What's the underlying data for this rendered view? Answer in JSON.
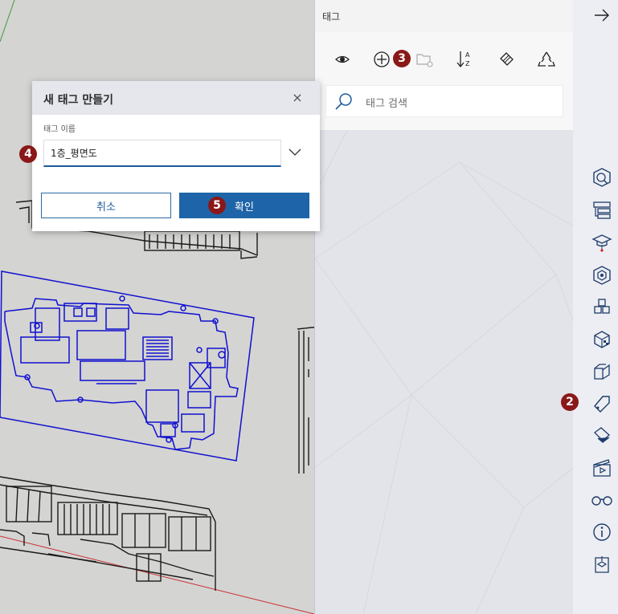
{
  "tag_panel": {
    "title": "태그",
    "search_placeholder": "태그 검색",
    "toolbar": [
      "eye-icon",
      "add-tag-icon",
      "folder-icon",
      "sort-az-icon",
      "tag-tool-icon",
      "purge-icon"
    ]
  },
  "right_tray": {
    "collapse_icon": "arrow-right-icon",
    "icons": [
      "entity-info-icon",
      "outliner-icon",
      "instructor-icon",
      "components-icon",
      "materials-cubes-icon",
      "styles-icon",
      "shadows-icon",
      "tags-icon",
      "soften-edges-icon",
      "scenes-icon",
      "glasses-icon",
      "info-icon",
      "export-icon"
    ]
  },
  "dialog": {
    "title": "새 태그 만들기",
    "close_label": "×",
    "field_label": "태그 이름",
    "name_value": "1층_평면도",
    "cancel_label": "취소",
    "ok_label": "확인"
  },
  "badges": {
    "b2": "2",
    "b3": "3",
    "b4": "4",
    "b5": "5"
  },
  "colors": {
    "accent": "#1e64a8",
    "badge": "#8a1818",
    "drawing_selected": "#1010d0"
  }
}
